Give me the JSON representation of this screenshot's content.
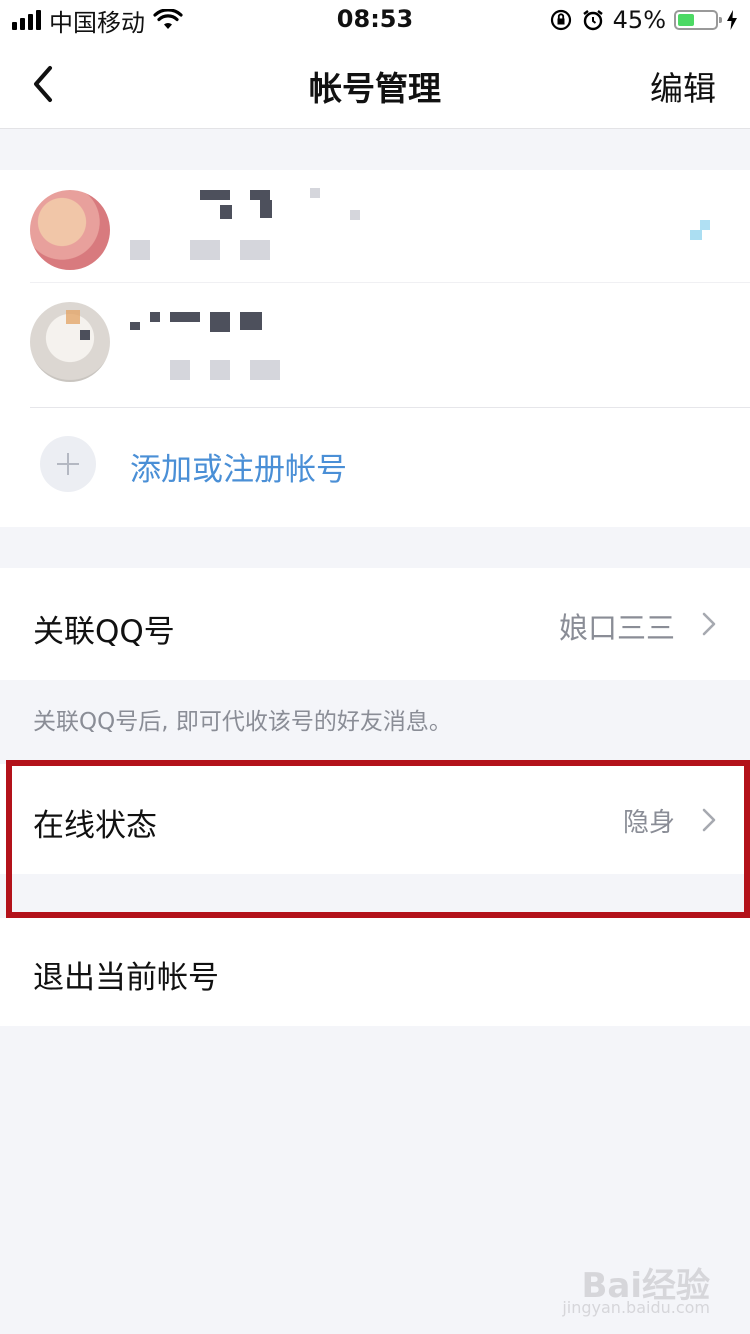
{
  "status_bar": {
    "carrier": "中国移动",
    "time": "08:53",
    "battery_percent": "45%",
    "battery_level": 0.45,
    "battery_color": "#4cd964"
  },
  "nav": {
    "title": "帐号管理",
    "edit_label": "编辑",
    "back_icon": "chevron-left-icon"
  },
  "accounts": {
    "add_label": "添加或注册帐号",
    "add_icon": "plus-icon"
  },
  "linked_qq": {
    "label": "关联QQ号",
    "value": "娘口三三",
    "hint": "关联QQ号后, 即可代收该号的好友消息。"
  },
  "online_status": {
    "label": "在线状态",
    "value": "隐身"
  },
  "logout": {
    "label": "退出当前帐号"
  },
  "watermark": {
    "brand": "Bai经验",
    "url": "jingyan.baidu.com"
  },
  "colors": {
    "accent_blue": "#4a8fd6",
    "highlight_red": "#b3121a"
  }
}
